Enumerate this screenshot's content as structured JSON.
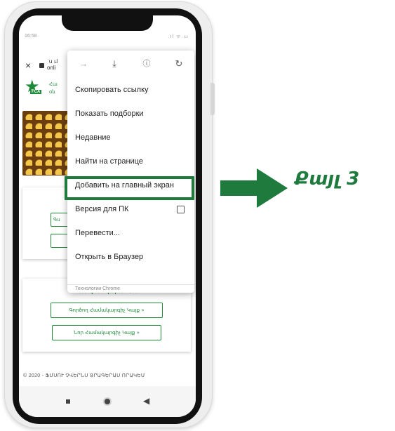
{
  "status": {
    "time": "16:58",
    "icons": ".ıl ᯤ ▭"
  },
  "browser": {
    "close_glyph": "×",
    "url_text": "ʿս ւl onli"
  },
  "site": {
    "logo_text": "FCA",
    "title_text": "Հա օն"
  },
  "page": {
    "card1_button_text": "Գս",
    "card2_title": "Պատգոտոկարահ ձոհ",
    "card2_button_1": "Գործող Համակարգիչ Կայք »",
    "card2_button_2": "Նոր Համակարգիչ Կայք »",
    "footer": "© 2020 - ՖՄՍՈՒ ՉՎԵՐՆՍ ՑՐԱԳԵՐԱՍ ՈՐԱԿԵՄ"
  },
  "menu": {
    "toolbar": {
      "forward_icon": "arrow-forward-icon",
      "download_icon": "download-icon",
      "info_icon": "info-icon",
      "reload_icon": "reload-icon"
    },
    "items": [
      "Скопировать ссылку",
      "Показать подборки",
      "Недавние",
      "Найти на странице",
      "Добавить на главный экран",
      "Версия для ПК",
      "Перевести...",
      "Открыть в Браузер"
    ],
    "footer": "Технологии Chrome"
  },
  "callout": {
    "step_label": "Քայլ 3",
    "arrow_color": "#1f7a3e",
    "highlight_color": "#1f7a3e"
  },
  "colors": {
    "brand_green": "#1f8a3a"
  }
}
